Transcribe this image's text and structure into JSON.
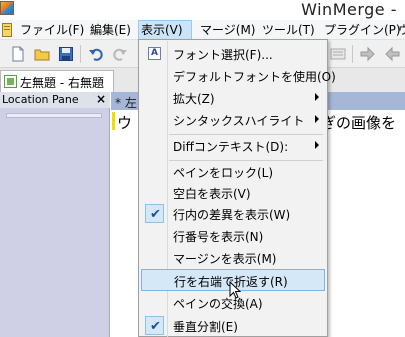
{
  "window": {
    "title": "WinMerge -"
  },
  "menubar": {
    "items": [
      {
        "id": "file",
        "label": "ファイル(F)"
      },
      {
        "id": "edit",
        "label": "編集(E)"
      },
      {
        "id": "view",
        "label": "表示(V)",
        "active": true
      },
      {
        "id": "merge",
        "label": "マージ(M)"
      },
      {
        "id": "tools",
        "label": "ツール(T)"
      },
      {
        "id": "plugins",
        "label": "プラグイン(P)"
      },
      {
        "id": "window",
        "label": "ウ"
      }
    ]
  },
  "tab": {
    "label": "左無題 - 右無題"
  },
  "location_pane": {
    "title": "Location Pane",
    "close": "×"
  },
  "editor": {
    "header_text": "* 左",
    "line_left": "ウ",
    "line_right": "ぎの画像を"
  },
  "dropdown": {
    "items": [
      {
        "label": "フォント選択(F)...",
        "icon": "font-icon"
      },
      {
        "label": "デフォルトフォントを使用(O)"
      },
      {
        "label": "拡大(Z)",
        "submenu": true
      },
      {
        "label": "シンタックスハイライト",
        "submenu": true
      },
      {
        "label": "Diffコンテキスト(D):",
        "submenu": true
      },
      {
        "label": "ペインをロック(L)"
      },
      {
        "label": "空白を表示(V)"
      },
      {
        "label": "行内の差異を表示(W)",
        "checked": true
      },
      {
        "label": "行番号を表示(N)"
      },
      {
        "label": "マージンを表示(M)"
      },
      {
        "label": "行を右端で折返す(R)",
        "highlighted": true
      },
      {
        "label": "ペインの交換(A)"
      },
      {
        "label": "垂直分割(E)",
        "checked": true
      }
    ]
  },
  "colors": {
    "menu_highlight": "#d5e8f8",
    "location_pane": "#cfcfe6",
    "pane_header": "#a5b6d6"
  }
}
